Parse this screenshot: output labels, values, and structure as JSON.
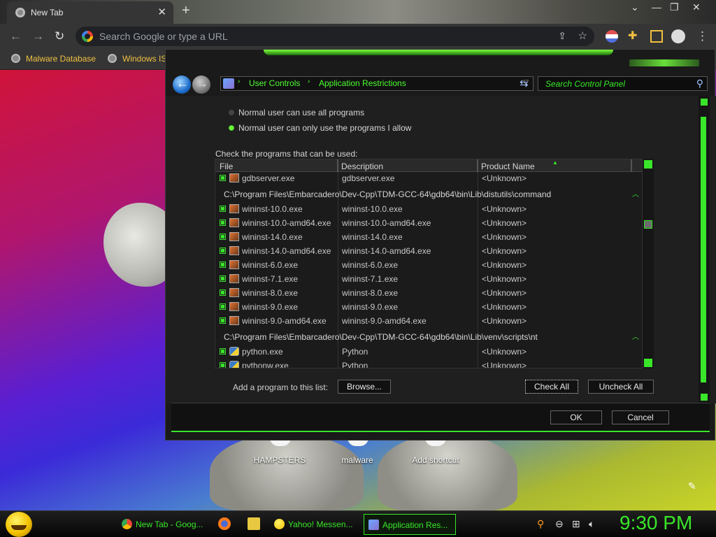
{
  "browser": {
    "tab_title": "New Tab",
    "omnibox_placeholder": "Search Google or type a URL",
    "bookmarks": [
      "Malware Database",
      "Windows IS"
    ]
  },
  "desktop": {
    "shortcuts": [
      "HAMPSTERS",
      "malware",
      "Add shortcut"
    ]
  },
  "dialog": {
    "breadcrumbs": [
      "User Controls",
      "Application Restrictions"
    ],
    "search_placeholder": "Search Control Panel",
    "radio_options": [
      {
        "label": "Normal user can use all programs",
        "selected": false
      },
      {
        "label": "Normal user can only use the programs I allow",
        "selected": true
      }
    ],
    "check_label": "Check the programs that can be used:",
    "columns": [
      "File",
      "Description",
      "Product Name"
    ],
    "table": {
      "row_top": {
        "file": "gdbserver.exe",
        "desc": "gdbserver.exe",
        "product": "<Unknown>"
      },
      "group1": "C:\\Program Files\\Embarcadero\\Dev-Cpp\\TDM-GCC-64\\gdb64\\bin\\Lib\\distutils\\command",
      "group1_rows": [
        {
          "file": "wininst-10.0.exe",
          "desc": "wininst-10.0.exe",
          "product": "<Unknown>"
        },
        {
          "file": "wininst-10.0-amd64.exe",
          "desc": "wininst-10.0-amd64.exe",
          "product": "<Unknown>"
        },
        {
          "file": "wininst-14.0.exe",
          "desc": "wininst-14.0.exe",
          "product": "<Unknown>"
        },
        {
          "file": "wininst-14.0-amd64.exe",
          "desc": "wininst-14.0-amd64.exe",
          "product": "<Unknown>"
        },
        {
          "file": "wininst-6.0.exe",
          "desc": "wininst-6.0.exe",
          "product": "<Unknown>"
        },
        {
          "file": "wininst-7.1.exe",
          "desc": "wininst-7.1.exe",
          "product": "<Unknown>"
        },
        {
          "file": "wininst-8.0.exe",
          "desc": "wininst-8.0.exe",
          "product": "<Unknown>"
        },
        {
          "file": "wininst-9.0.exe",
          "desc": "wininst-9.0.exe",
          "product": "<Unknown>"
        },
        {
          "file": "wininst-9.0-amd64.exe",
          "desc": "wininst-9.0-amd64.exe",
          "product": "<Unknown>"
        }
      ],
      "group2": "C:\\Program Files\\Embarcadero\\Dev-Cpp\\TDM-GCC-64\\gdb64\\bin\\Lib\\venv\\scripts\\nt",
      "group2_rows": [
        {
          "file": "python.exe",
          "desc": "Python",
          "product": "<Unknown>"
        },
        {
          "file": "pythonw.exe",
          "desc": "Python",
          "product": "<Unknown>"
        }
      ]
    },
    "add_label": "Add a program to this list:",
    "browse": "Browse...",
    "check_all": "Check All",
    "uncheck_all": "Uncheck All",
    "ok": "OK",
    "cancel": "Cancel"
  },
  "taskbar": {
    "tasks": [
      "New Tab - Goog...",
      "Yahoo! Messen...",
      "Application Res..."
    ],
    "clock": "9:30 PM"
  },
  "colors": {
    "accent": "#39e62a",
    "bookmark_text": "#f0c040"
  },
  "icons": [
    "chrome-icon",
    "back-arrow-icon",
    "forward-arrow-icon",
    "reload-icon",
    "share-icon",
    "star-icon",
    "puzzle-icon",
    "sidebar-icon",
    "profile-icon",
    "menu-icon",
    "control-panel-icon",
    "refresh-icon",
    "magnifier-icon",
    "executable-icon",
    "python-icon",
    "firefox-icon",
    "folder-icon",
    "smiley-icon",
    "search-icon",
    "volume-icon",
    "network-icon",
    "pencil-icon"
  ]
}
